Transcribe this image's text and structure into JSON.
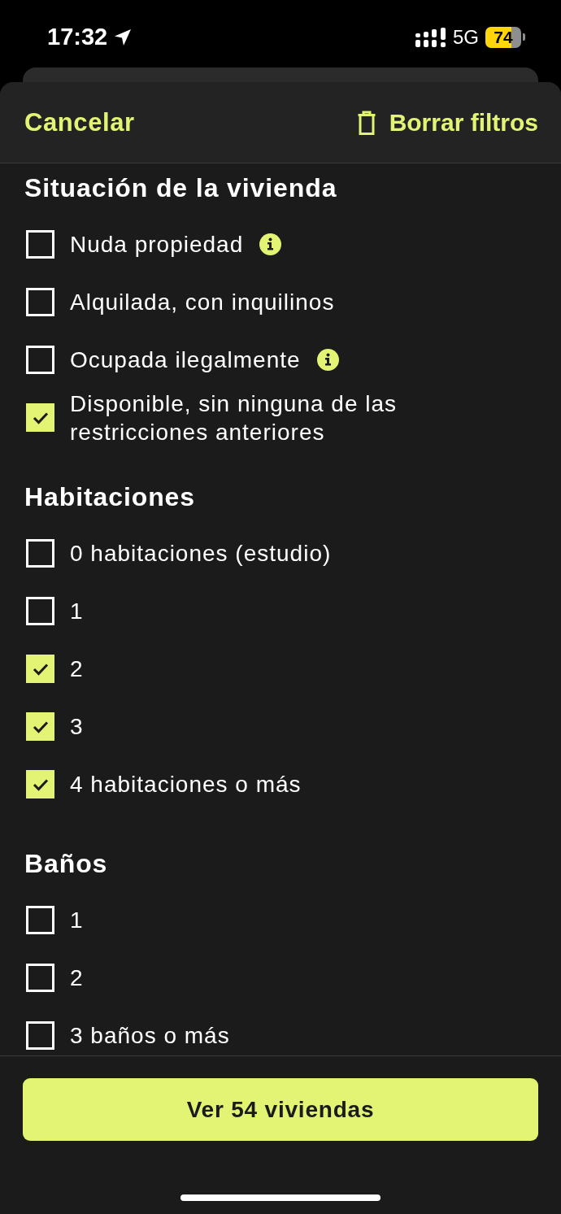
{
  "status_bar": {
    "time": "17:32",
    "network": "5G",
    "battery": "74"
  },
  "header": {
    "cancel": "Cancelar",
    "clear": "Borrar filtros"
  },
  "sections": [
    {
      "title": "Situación de la vivienda",
      "options": [
        {
          "label": "Nuda propiedad",
          "checked": false,
          "info": true
        },
        {
          "label": "Alquilada, con inquilinos",
          "checked": false,
          "info": false
        },
        {
          "label": "Ocupada ilegalmente",
          "checked": false,
          "info": true
        },
        {
          "label": "Disponible, sin ninguna de las restricciones anteriores",
          "checked": true,
          "info": false
        }
      ]
    },
    {
      "title": "Habitaciones",
      "options": [
        {
          "label": "0 habitaciones (estudio)",
          "checked": false,
          "info": false
        },
        {
          "label": "1",
          "checked": false,
          "info": false
        },
        {
          "label": "2",
          "checked": true,
          "info": false
        },
        {
          "label": "3",
          "checked": true,
          "info": false
        },
        {
          "label": "4 habitaciones o más",
          "checked": true,
          "info": false
        }
      ]
    },
    {
      "title": "Baños",
      "options": [
        {
          "label": "1",
          "checked": false,
          "info": false
        },
        {
          "label": "2",
          "checked": false,
          "info": false
        },
        {
          "label": "3 baños o más",
          "checked": false,
          "info": false
        }
      ]
    }
  ],
  "footer": {
    "button": "Ver 54 viviendas"
  }
}
